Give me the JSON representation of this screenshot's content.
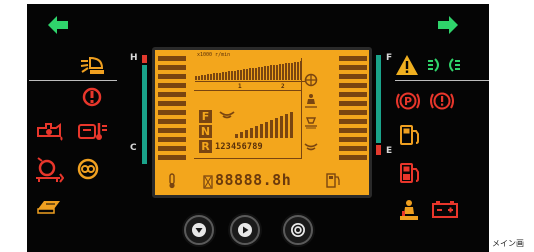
{
  "panel": {
    "gauge_left": {
      "top_label": "H",
      "bottom_label": "C"
    },
    "gauge_right": {
      "top_label": "F",
      "bottom_label": "E"
    }
  },
  "lcd": {
    "rpm_unit": "x1000 r/min",
    "rpm_scale_1": "1",
    "rpm_scale_2": "2",
    "gears": [
      "F",
      "N",
      "R"
    ],
    "gear_numbers": "123456789",
    "hour_meter": "88888.8h"
  },
  "buttons": [
    {
      "name": "down-button",
      "icon": "triangle-down-icon"
    },
    {
      "name": "play-button",
      "icon": "triangle-right-icon"
    },
    {
      "name": "select-button",
      "icon": "circle-dot-icon"
    }
  ],
  "caption": "メイン画",
  "colors": {
    "green": "#2fd46b",
    "orange": "#f0a020",
    "red": "#e8362b",
    "teal": "#1aa38a",
    "lcd": "#f3a61c"
  },
  "icons": {
    "left": [
      "turn-left-arrow-icon",
      "work-light-icon",
      "engine-oil-pressure-icon",
      "engine-oil-icon",
      "hydraulic-temp-icon",
      "transmission-icon",
      "filter-icon",
      "seat-belt-manual-icon"
    ],
    "right": [
      "turn-right-arrow-icon",
      "warning-triangle-icon",
      "headlight-icon",
      "parking-brake-icon",
      "brake-warning-icon",
      "fuel-filter-icon",
      "water-in-fuel-icon",
      "operator-presence-icon",
      "battery-icon"
    ]
  }
}
